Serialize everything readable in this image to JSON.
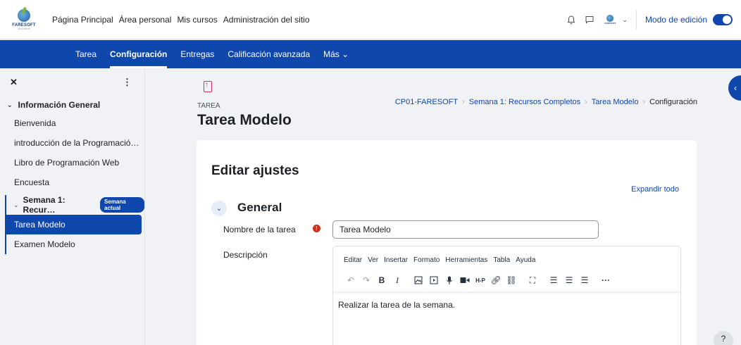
{
  "brand": {
    "logo_text": "FARESOFT",
    "logo_sub": "SOLUTIONS"
  },
  "topnav": {
    "items": [
      "Página Principal",
      "Área personal",
      "Mis cursos",
      "Administración del sitio"
    ],
    "edit_mode_label": "Modo de edición",
    "edit_mode_on": true
  },
  "icons": {
    "bell": "bell-icon",
    "chat": "chat-icon",
    "caret": "chevron-down-icon"
  },
  "secnav": {
    "items": [
      "Tarea",
      "Configuración",
      "Entregas",
      "Calificación avanzada",
      "Más ⌄"
    ],
    "active": "Configuración"
  },
  "drawer": {
    "sections": [
      {
        "label": "Información General",
        "items": [
          "Bienvenida",
          "introducción de la Programación…",
          "Libro de Programación Web",
          "Encuesta"
        ]
      }
    ],
    "current_section": {
      "label": "Semana 1: Recur…",
      "badge": "Semana actual",
      "active_item": "Tarea Modelo",
      "other_item": "Examen Modelo"
    }
  },
  "page": {
    "activity_type": "TAREA",
    "title": "Tarea Modelo",
    "breadcrumb": [
      "CP01-FARESOFT",
      "Semana 1: Recursos Completos",
      "Tarea Modelo",
      "Configuración"
    ]
  },
  "form": {
    "heading": "Editar ajustes",
    "expand_all": "Expandir todo",
    "section_title": "General",
    "name_label": "Nombre de la tarea",
    "name_value": "Tarea Modelo",
    "description_label": "Descripción",
    "editor_menu": [
      "Editar",
      "Ver",
      "Insertar",
      "Formato",
      "Herramientas",
      "Tabla",
      "Ayuda"
    ],
    "description_text": "Realizar la tarea de la semana."
  },
  "colors": {
    "primary": "#0f47ad",
    "required": "#ca3120",
    "assign_icon": "#d6286d"
  },
  "help": "?"
}
